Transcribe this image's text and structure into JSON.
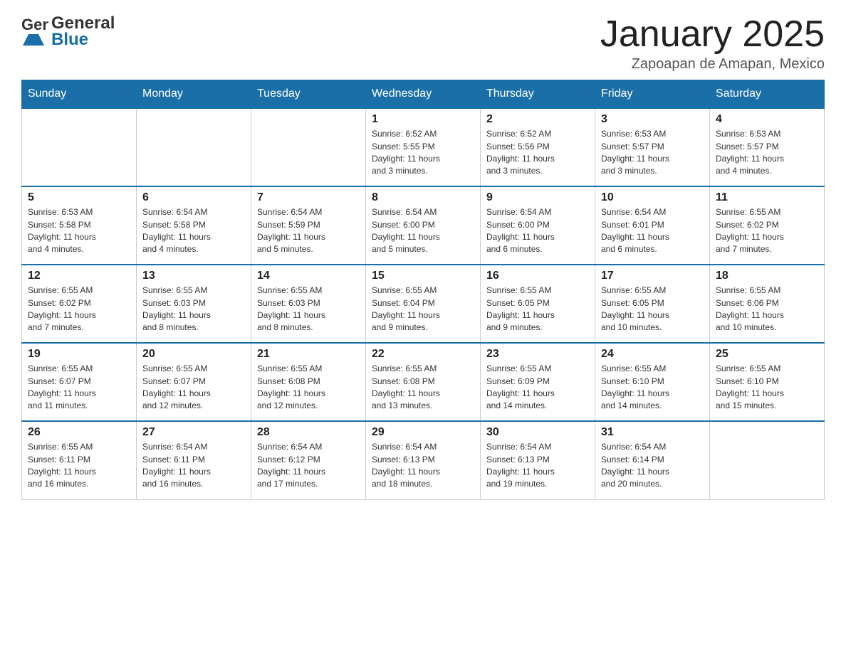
{
  "header": {
    "logo_general": "General",
    "logo_blue": "Blue",
    "month_title": "January 2025",
    "location": "Zapoapan de Amapan, Mexico"
  },
  "weekdays": [
    "Sunday",
    "Monday",
    "Tuesday",
    "Wednesday",
    "Thursday",
    "Friday",
    "Saturday"
  ],
  "weeks": [
    [
      {
        "day": "",
        "info": ""
      },
      {
        "day": "",
        "info": ""
      },
      {
        "day": "",
        "info": ""
      },
      {
        "day": "1",
        "info": "Sunrise: 6:52 AM\nSunset: 5:55 PM\nDaylight: 11 hours\nand 3 minutes."
      },
      {
        "day": "2",
        "info": "Sunrise: 6:52 AM\nSunset: 5:56 PM\nDaylight: 11 hours\nand 3 minutes."
      },
      {
        "day": "3",
        "info": "Sunrise: 6:53 AM\nSunset: 5:57 PM\nDaylight: 11 hours\nand 3 minutes."
      },
      {
        "day": "4",
        "info": "Sunrise: 6:53 AM\nSunset: 5:57 PM\nDaylight: 11 hours\nand 4 minutes."
      }
    ],
    [
      {
        "day": "5",
        "info": "Sunrise: 6:53 AM\nSunset: 5:58 PM\nDaylight: 11 hours\nand 4 minutes."
      },
      {
        "day": "6",
        "info": "Sunrise: 6:54 AM\nSunset: 5:58 PM\nDaylight: 11 hours\nand 4 minutes."
      },
      {
        "day": "7",
        "info": "Sunrise: 6:54 AM\nSunset: 5:59 PM\nDaylight: 11 hours\nand 5 minutes."
      },
      {
        "day": "8",
        "info": "Sunrise: 6:54 AM\nSunset: 6:00 PM\nDaylight: 11 hours\nand 5 minutes."
      },
      {
        "day": "9",
        "info": "Sunrise: 6:54 AM\nSunset: 6:00 PM\nDaylight: 11 hours\nand 6 minutes."
      },
      {
        "day": "10",
        "info": "Sunrise: 6:54 AM\nSunset: 6:01 PM\nDaylight: 11 hours\nand 6 minutes."
      },
      {
        "day": "11",
        "info": "Sunrise: 6:55 AM\nSunset: 6:02 PM\nDaylight: 11 hours\nand 7 minutes."
      }
    ],
    [
      {
        "day": "12",
        "info": "Sunrise: 6:55 AM\nSunset: 6:02 PM\nDaylight: 11 hours\nand 7 minutes."
      },
      {
        "day": "13",
        "info": "Sunrise: 6:55 AM\nSunset: 6:03 PM\nDaylight: 11 hours\nand 8 minutes."
      },
      {
        "day": "14",
        "info": "Sunrise: 6:55 AM\nSunset: 6:03 PM\nDaylight: 11 hours\nand 8 minutes."
      },
      {
        "day": "15",
        "info": "Sunrise: 6:55 AM\nSunset: 6:04 PM\nDaylight: 11 hours\nand 9 minutes."
      },
      {
        "day": "16",
        "info": "Sunrise: 6:55 AM\nSunset: 6:05 PM\nDaylight: 11 hours\nand 9 minutes."
      },
      {
        "day": "17",
        "info": "Sunrise: 6:55 AM\nSunset: 6:05 PM\nDaylight: 11 hours\nand 10 minutes."
      },
      {
        "day": "18",
        "info": "Sunrise: 6:55 AM\nSunset: 6:06 PM\nDaylight: 11 hours\nand 10 minutes."
      }
    ],
    [
      {
        "day": "19",
        "info": "Sunrise: 6:55 AM\nSunset: 6:07 PM\nDaylight: 11 hours\nand 11 minutes."
      },
      {
        "day": "20",
        "info": "Sunrise: 6:55 AM\nSunset: 6:07 PM\nDaylight: 11 hours\nand 12 minutes."
      },
      {
        "day": "21",
        "info": "Sunrise: 6:55 AM\nSunset: 6:08 PM\nDaylight: 11 hours\nand 12 minutes."
      },
      {
        "day": "22",
        "info": "Sunrise: 6:55 AM\nSunset: 6:08 PM\nDaylight: 11 hours\nand 13 minutes."
      },
      {
        "day": "23",
        "info": "Sunrise: 6:55 AM\nSunset: 6:09 PM\nDaylight: 11 hours\nand 14 minutes."
      },
      {
        "day": "24",
        "info": "Sunrise: 6:55 AM\nSunset: 6:10 PM\nDaylight: 11 hours\nand 14 minutes."
      },
      {
        "day": "25",
        "info": "Sunrise: 6:55 AM\nSunset: 6:10 PM\nDaylight: 11 hours\nand 15 minutes."
      }
    ],
    [
      {
        "day": "26",
        "info": "Sunrise: 6:55 AM\nSunset: 6:11 PM\nDaylight: 11 hours\nand 16 minutes."
      },
      {
        "day": "27",
        "info": "Sunrise: 6:54 AM\nSunset: 6:11 PM\nDaylight: 11 hours\nand 16 minutes."
      },
      {
        "day": "28",
        "info": "Sunrise: 6:54 AM\nSunset: 6:12 PM\nDaylight: 11 hours\nand 17 minutes."
      },
      {
        "day": "29",
        "info": "Sunrise: 6:54 AM\nSunset: 6:13 PM\nDaylight: 11 hours\nand 18 minutes."
      },
      {
        "day": "30",
        "info": "Sunrise: 6:54 AM\nSunset: 6:13 PM\nDaylight: 11 hours\nand 19 minutes."
      },
      {
        "day": "31",
        "info": "Sunrise: 6:54 AM\nSunset: 6:14 PM\nDaylight: 11 hours\nand 20 minutes."
      },
      {
        "day": "",
        "info": ""
      }
    ]
  ]
}
